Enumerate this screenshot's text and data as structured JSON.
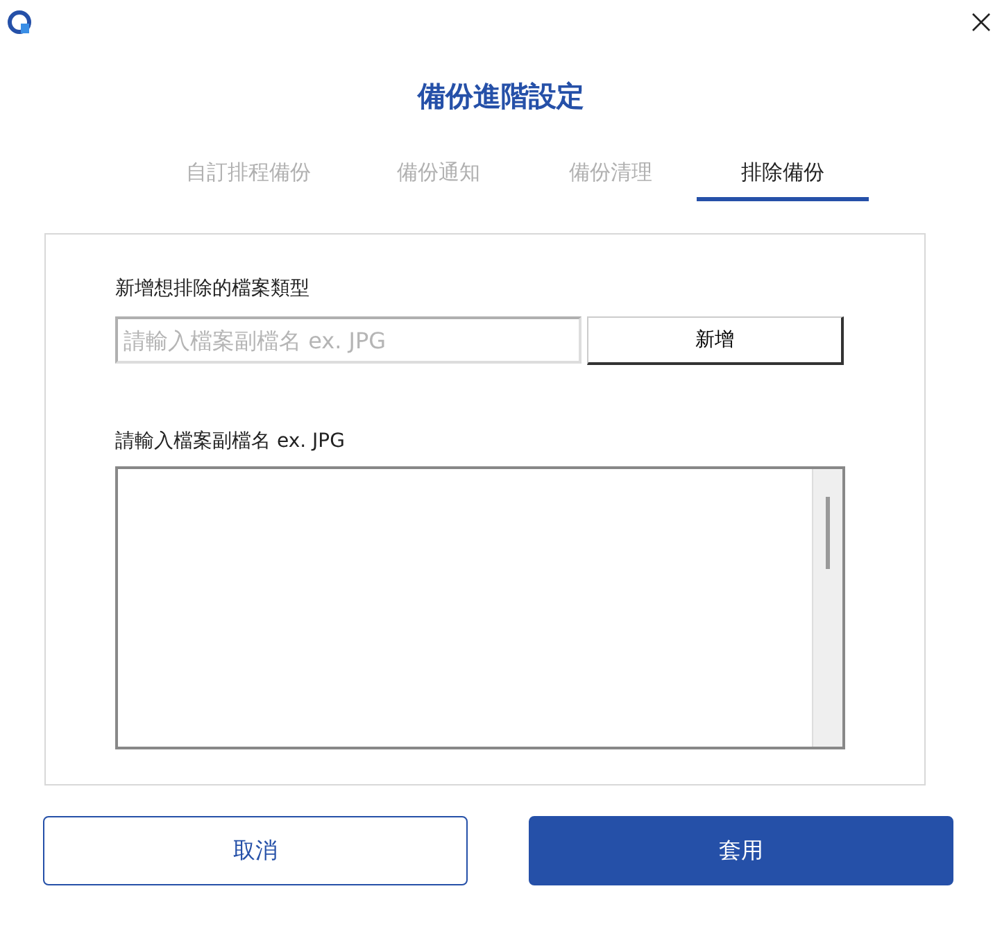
{
  "window": {
    "title": "備份進階設定"
  },
  "tabs": [
    {
      "label": "自訂排程備份",
      "selected": false
    },
    {
      "label": "備份通知",
      "selected": false
    },
    {
      "label": "備份清理",
      "selected": false
    },
    {
      "label": "排除備份",
      "selected": true
    }
  ],
  "add_section": {
    "label": "新增想排除的檔案類型",
    "field": {
      "placeholder": "請輸入檔案副檔名 ex. JPG"
    },
    "button": "新增"
  },
  "list_section": {
    "label": "請輸入檔案副檔名 ex. JPG"
  },
  "buttons": [
    {
      "label": "取消",
      "kind": "secondary"
    },
    {
      "label": "套用",
      "kind": "primary"
    }
  ]
}
